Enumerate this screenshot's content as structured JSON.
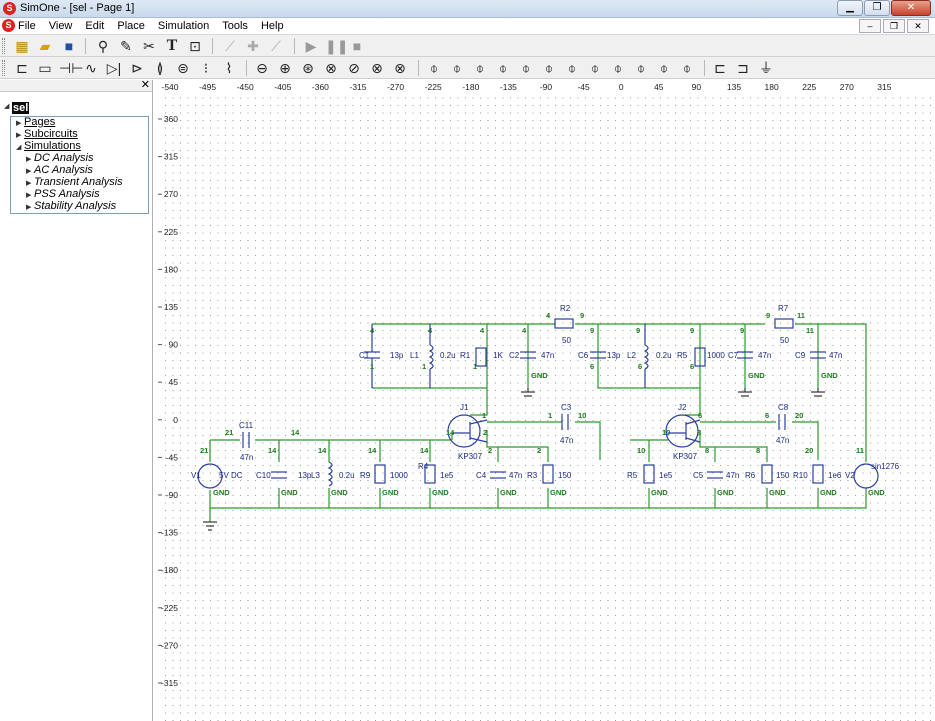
{
  "window": {
    "title": "SimOne - [sel - Page 1]",
    "app_icon": "simone-logo-icon"
  },
  "menubar": {
    "items": [
      "File",
      "View",
      "Edit",
      "Place",
      "Simulation",
      "Tools",
      "Help"
    ]
  },
  "toolbar1": {
    "icons": [
      "new-project-icon",
      "open-folder-icon",
      "save-icon",
      "zoom-icon",
      "pencil-icon",
      "cut-wire-icon",
      "text-icon",
      "component-icon",
      "chart-icon",
      "add-icon",
      "probe-icon",
      "play-icon",
      "pause-icon",
      "stop-icon"
    ]
  },
  "toolbar2": {
    "icons": [
      "ground-symbol-icon",
      "resistor-icon",
      "capacitor-icon",
      "inductor-icon",
      "diode-icon",
      "zener-icon",
      "transformer-icon",
      "coupled-inductor-icon",
      "switch-icon",
      "npn-icon",
      "pnp-icon",
      "jfet-icon",
      "mosfet-n-icon",
      "mosfet-p-icon",
      "igbt-icon",
      "voltage-source-icon",
      "current-source-icon",
      "vcvs-icon",
      "ccvs-icon",
      "vccs-icon",
      "cccs-icon",
      "source-f-icon",
      "source-g-icon",
      "port-in-icon",
      "port-out-icon",
      "ground-icon"
    ]
  },
  "project_tree": {
    "root": "sel",
    "items": [
      "Pages",
      "Subcircuits",
      "Simulations"
    ],
    "simulations": [
      "DC Analysis",
      "AC Analysis",
      "Transient Analysis",
      "PSS Analysis",
      "Stability Analysis"
    ]
  },
  "ruler": {
    "x_ticks": [
      "-540",
      "-495",
      "-450",
      "-405",
      "-360",
      "-315",
      "-270",
      "-225",
      "-180",
      "-135",
      "-90",
      "-45",
      "0",
      "45",
      "90",
      "135",
      "180",
      "225",
      "270",
      "315"
    ],
    "y_ticks": [
      "360",
      "315",
      "270",
      "225",
      "180",
      "135",
      "90",
      "45",
      "0",
      "-45",
      "-90",
      "-135",
      "-180",
      "-225",
      "-270",
      "-315"
    ]
  },
  "schematic": {
    "components": {
      "C1": "13p",
      "L1": "0.2u",
      "R1": "1K",
      "C2": "47n",
      "R2": "50",
      "C6": "13p",
      "L2": "0.2u",
      "R5": "1000",
      "C7": "47n",
      "R7": "50",
      "C9": "47n",
      "C3": "47n",
      "C8": "47n",
      "J1": "KP307",
      "J2": "KP307",
      "C11": "47n",
      "V1": "5V DC",
      "C10": "13p",
      "L3": "0.2u",
      "R9": "1000",
      "R4": "1e5",
      "C4": "47n",
      "R3": "150",
      "R5b": "1e5",
      "C5": "47n",
      "R6": "150",
      "R10": "1e6",
      "V2": "sin1276"
    },
    "ground_label": "GND"
  }
}
